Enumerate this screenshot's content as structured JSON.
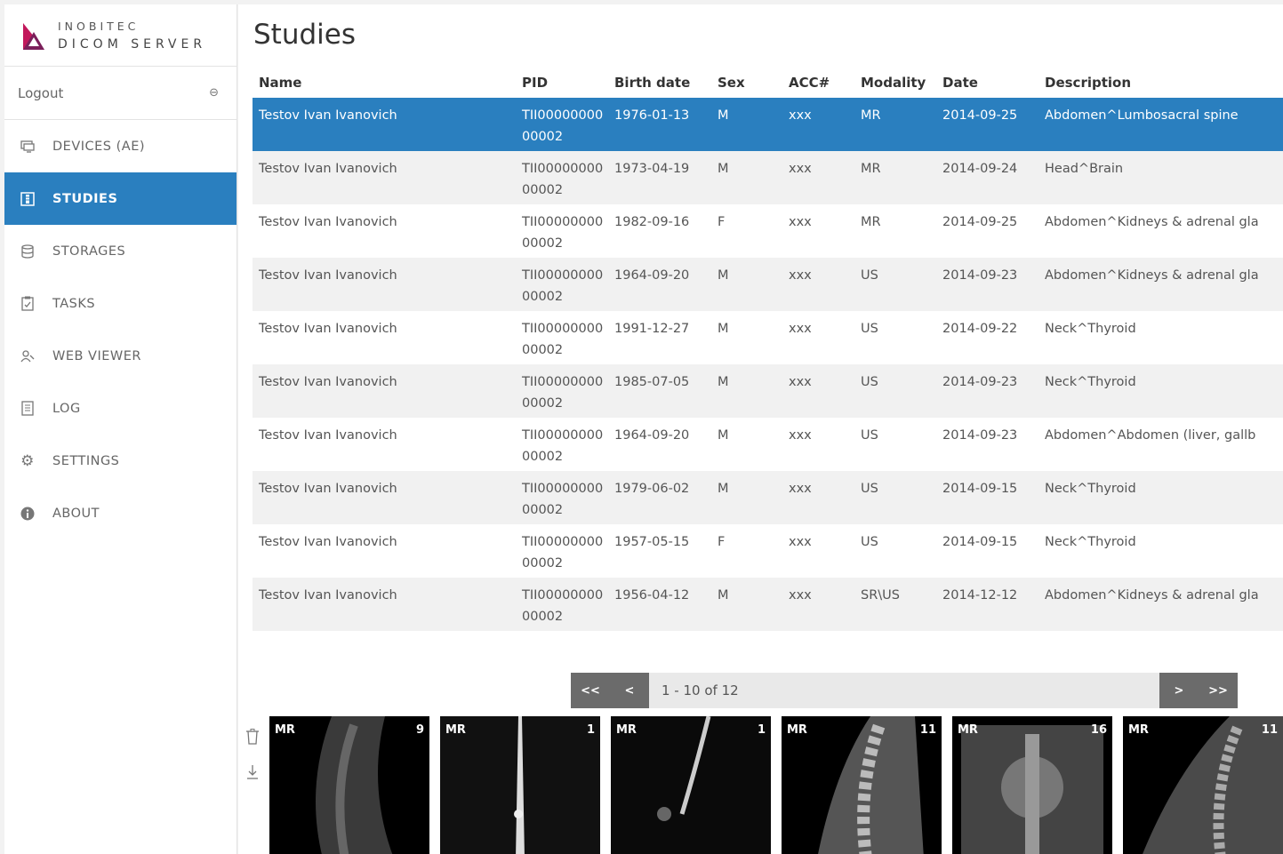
{
  "brand": {
    "line1": "INOBITEC",
    "line2": "DICOM SERVER"
  },
  "logout": {
    "label": "Logout",
    "icon": "logout-icon"
  },
  "nav": [
    {
      "label": "DEVICES (AE)",
      "icon": "monitor-icon"
    },
    {
      "label": "STUDIES",
      "icon": "studies-icon",
      "active": true
    },
    {
      "label": "STORAGES",
      "icon": "database-icon"
    },
    {
      "label": "TASKS",
      "icon": "clipboard-icon"
    },
    {
      "label": "WEB VIEWER",
      "icon": "viewer-icon"
    },
    {
      "label": "LOG",
      "icon": "log-icon"
    },
    {
      "label": "SETTINGS",
      "icon": "gear-icon"
    },
    {
      "label": "ABOUT",
      "icon": "info-icon"
    }
  ],
  "page": {
    "title": "Studies"
  },
  "table": {
    "headers": [
      "Name",
      "PID",
      "Birth date",
      "Sex",
      "ACC#",
      "Modality",
      "Date",
      "Description"
    ],
    "rows": [
      [
        "Testov Ivan Ivanovich",
        "TII0000000000002",
        "1976-01-13",
        "M",
        "xxx",
        "MR",
        "2014-09-25",
        "Abdomen^Lumbosacral spine"
      ],
      [
        "Testov Ivan Ivanovich",
        "TII0000000000002",
        "1973-04-19",
        "M",
        "xxx",
        "MR",
        "2014-09-24",
        "Head^Brain"
      ],
      [
        "Testov Ivan Ivanovich",
        "TII0000000000002",
        "1982-09-16",
        "F",
        "xxx",
        "MR",
        "2014-09-25",
        "Abdomen^Kidneys & adrenal gla"
      ],
      [
        "Testov Ivan Ivanovich",
        "TII0000000000002",
        "1964-09-20",
        "M",
        "xxx",
        "US",
        "2014-09-23",
        "Abdomen^Kidneys & adrenal gla"
      ],
      [
        "Testov Ivan Ivanovich",
        "TII0000000000002",
        "1991-12-27",
        "M",
        "xxx",
        "US",
        "2014-09-22",
        "Neck^Thyroid"
      ],
      [
        "Testov Ivan Ivanovich",
        "TII0000000000002",
        "1985-07-05",
        "M",
        "xxx",
        "US",
        "2014-09-23",
        "Neck^Thyroid"
      ],
      [
        "Testov Ivan Ivanovich",
        "TII0000000000002",
        "1964-09-20",
        "M",
        "xxx",
        "US",
        "2014-09-23",
        "Abdomen^Abdomen (liver, gallb"
      ],
      [
        "Testov Ivan Ivanovich",
        "TII0000000000002",
        "1979-06-02",
        "M",
        "xxx",
        "US",
        "2014-09-15",
        "Neck^Thyroid"
      ],
      [
        "Testov Ivan Ivanovich",
        "TII0000000000002",
        "1957-05-15",
        "F",
        "xxx",
        "US",
        "2014-09-15",
        "Neck^Thyroid"
      ],
      [
        "Testov Ivan Ivanovich",
        "TII0000000000002",
        "1956-04-12",
        "M",
        "xxx",
        "SR\\US",
        "2014-12-12",
        "Abdomen^Kidneys & adrenal gla"
      ]
    ],
    "selected_row": 0
  },
  "pager": {
    "first": "<<",
    "prev": "<",
    "info": "1 - 10 of 12",
    "next": ">",
    "last": ">>"
  },
  "series_tools": {
    "delete_icon": "trash-icon",
    "download_icon": "download-icon"
  },
  "series": [
    {
      "modality": "MR",
      "count": "9"
    },
    {
      "modality": "MR",
      "count": "1"
    },
    {
      "modality": "MR",
      "count": "1"
    },
    {
      "modality": "MR",
      "count": "11"
    },
    {
      "modality": "MR",
      "count": "16"
    },
    {
      "modality": "MR",
      "count": "11"
    }
  ],
  "colors": {
    "accent": "#2a7fbf",
    "logo_red": "#c2185b",
    "logo_dark": "#6a1b4d",
    "pager_btn": "#6b6b6b"
  }
}
